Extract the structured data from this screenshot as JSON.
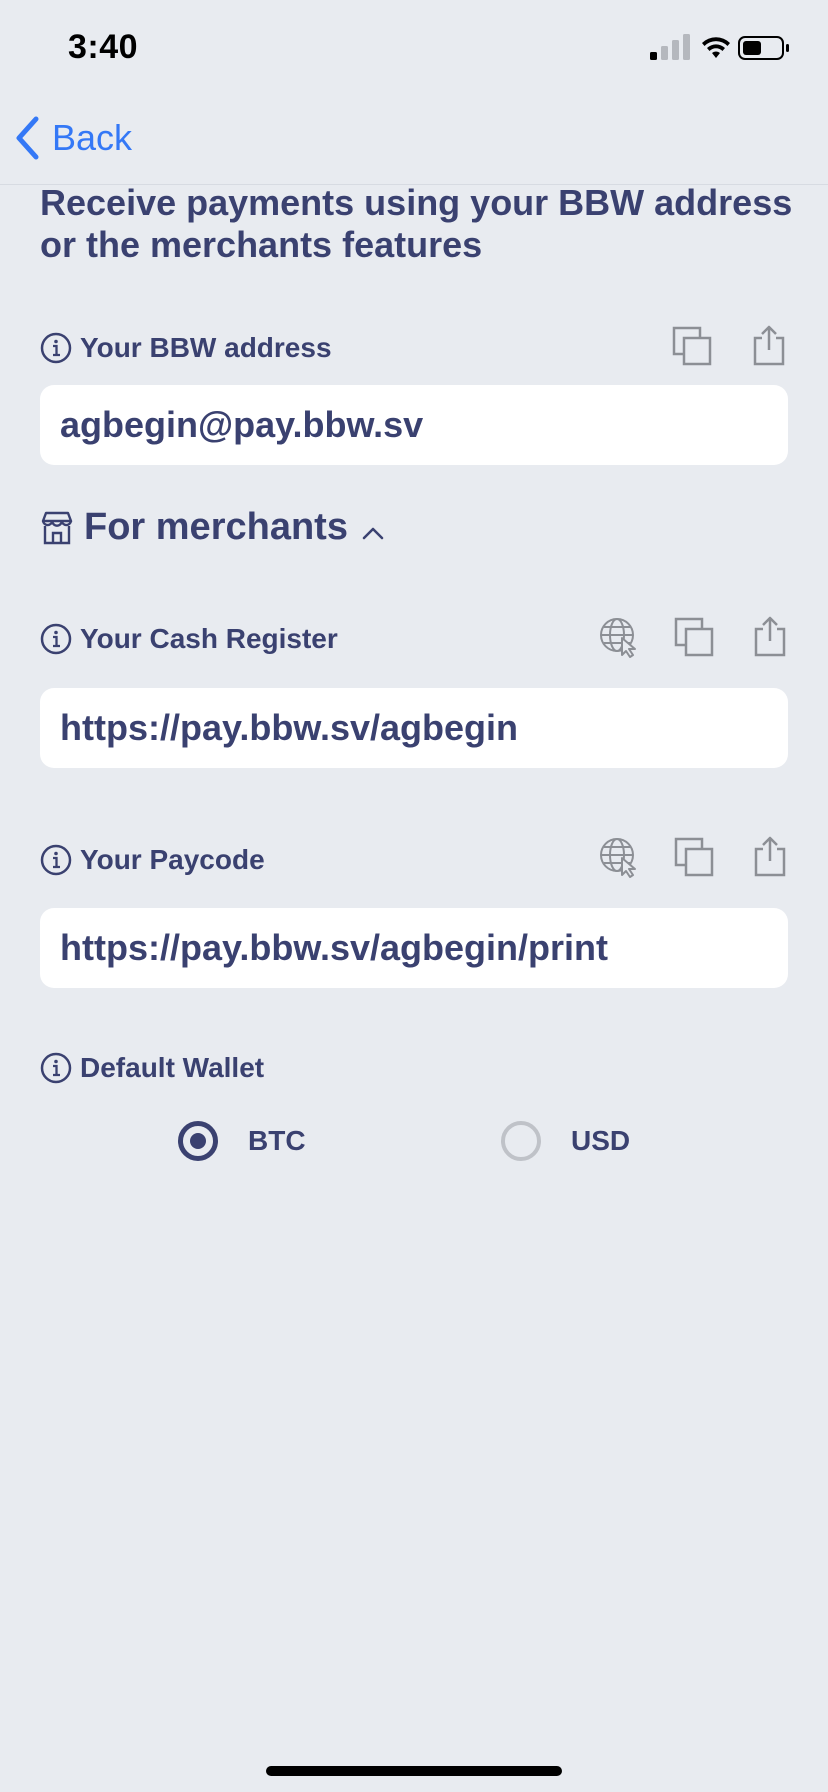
{
  "status_bar": {
    "time": "3:40"
  },
  "nav": {
    "back_label": "Back"
  },
  "intro": {
    "text": "Receive payments using your BBW address or the merchants features"
  },
  "bbw_address": {
    "label": "Your BBW address",
    "value": "agbegin@pay.bbw.sv"
  },
  "merchants": {
    "label": "For merchants"
  },
  "cash_register": {
    "label": "Your Cash Register",
    "value": "https://pay.bbw.sv/agbegin"
  },
  "paycode": {
    "label": "Your Paycode",
    "value": "https://pay.bbw.sv/agbegin/print"
  },
  "default_wallet": {
    "label": "Default Wallet",
    "options": [
      {
        "label": "BTC",
        "selected": true
      },
      {
        "label": "USD",
        "selected": false
      }
    ]
  },
  "colors": {
    "accent": "#3478F6",
    "text": "#3A4170",
    "background": "#E8EBF0"
  }
}
